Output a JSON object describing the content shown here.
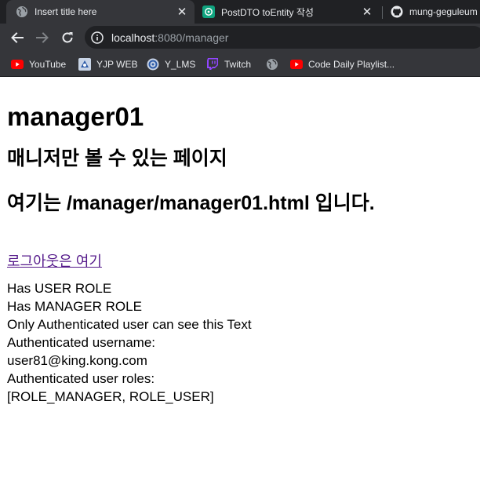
{
  "browser": {
    "tabs": [
      {
        "label": "Insert title here",
        "icon": "globe-icon",
        "active": true
      },
      {
        "label": "PostDTO toEntity 작성",
        "icon": "chatgpt-icon",
        "active": false
      },
      {
        "label": "mung-geguleum",
        "icon": "github-icon",
        "active": false
      }
    ],
    "close_glyph": "✕",
    "address": {
      "host": "localhost",
      "rest": ":8080/manager"
    },
    "bookmarks": [
      {
        "label": "YouTube",
        "icon": "youtube-icon"
      },
      {
        "label": "YJP WEB",
        "icon": "yjp-icon"
      },
      {
        "label": "Y_LMS",
        "icon": "lms-icon"
      },
      {
        "label": "Twitch",
        "icon": "twitch-icon"
      },
      {
        "label": "",
        "icon": "globe-icon"
      },
      {
        "label": "Code Daily Playlist...",
        "icon": "youtube-icon"
      }
    ],
    "colors": {
      "frame": "#202124",
      "toolbar": "#35363a",
      "text": "#e8eaed",
      "youtube_red": "#ff0000",
      "twitch_purple": "#9146ff",
      "chatgpt_green": "#10a37f"
    }
  },
  "page": {
    "title": "manager01",
    "heading1": "매니저만 볼 수 있는 페이지",
    "heading2": "여기는 /manager/manager01.html 입니다.",
    "logout_link": "로그아웃은 여기",
    "lines": [
      "Has USER ROLE",
      "Has MANAGER ROLE",
      "Only Authenticated user can see this Text",
      "Authenticated username:",
      "user81@king.kong.com",
      "Authenticated user roles:",
      "[ROLE_MANAGER, ROLE_USER]"
    ]
  }
}
